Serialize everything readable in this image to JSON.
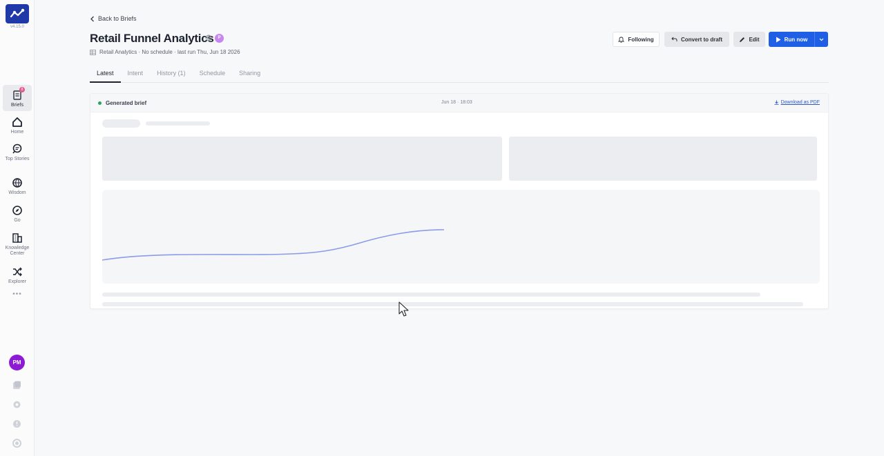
{
  "sidebar": {
    "version": "v4.15.0",
    "items": [
      {
        "label": "Briefs",
        "icon": "briefs-icon",
        "active": true,
        "badge": "8"
      },
      {
        "label": "Home",
        "icon": "home-icon"
      },
      {
        "label": "Top Stories",
        "icon": "top-stories-icon"
      },
      {
        "label": "Wisdom",
        "icon": "wisdom-icon"
      },
      {
        "label": "Go",
        "icon": "compass-icon"
      },
      {
        "label": "Knowledge Center",
        "icon": "building-icon"
      },
      {
        "label": "Explorer",
        "icon": "shuffle-icon"
      }
    ],
    "more": "•••",
    "avatar": "PM"
  },
  "header": {
    "back_label": "Back to Briefs",
    "title": "Retail Funnel Analytics",
    "badge": "P",
    "subtitle": "Retail Analytics · No schedule · last run Thu, Jun 18 2026"
  },
  "toolbar": {
    "following_label": "Following",
    "draft_label": "Convert to draft",
    "edit_label": "Edit",
    "run_label": "Run now",
    "run_dropdown": "⌄"
  },
  "tabs": [
    {
      "label": "Latest",
      "active": true
    },
    {
      "label": "Intent"
    },
    {
      "label": "History (1)"
    },
    {
      "label": "Schedule"
    },
    {
      "label": "Sharing"
    }
  ],
  "card": {
    "title": "Generated brief",
    "time": "Jun 18 · 18:03",
    "download_label": "Download as PDF"
  },
  "colors": {
    "accent": "#1f5fe6",
    "logo": "#1f3aa8",
    "status": "#2aa45a",
    "avatar": "#8e1bd4",
    "line": "#8a9be8"
  }
}
